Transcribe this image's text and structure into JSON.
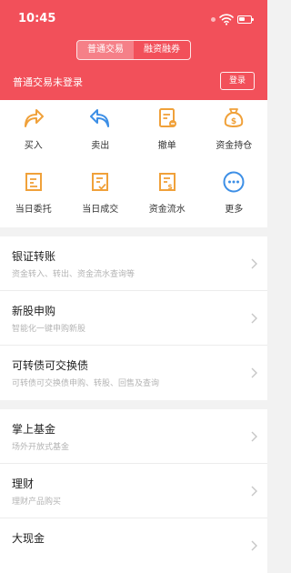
{
  "status_bar": {
    "time": "10:45"
  },
  "header": {
    "tabs": [
      "普通交易",
      "融资融券"
    ],
    "login_status": "普通交易未登录",
    "login_button": "登录"
  },
  "actions": [
    {
      "label": "买入",
      "icon": "buy-arrow-icon"
    },
    {
      "label": "卖出",
      "icon": "sell-arrow-icon"
    },
    {
      "label": "撤单",
      "icon": "cancel-order-icon"
    },
    {
      "label": "资金持仓",
      "icon": "money-bag-icon"
    },
    {
      "label": "当日委托",
      "icon": "today-order-icon"
    },
    {
      "label": "当日成交",
      "icon": "today-deal-icon"
    },
    {
      "label": "资金流水",
      "icon": "fund-flow-icon"
    },
    {
      "label": "更多",
      "icon": "more-icon"
    }
  ],
  "menu_group1": [
    {
      "title": "银证转账",
      "subtitle": "资金转入、转出、资金流水查询等"
    },
    {
      "title": "新股申购",
      "subtitle": "智能化一键申购新股"
    },
    {
      "title": "可转债可交换债",
      "subtitle": "可转债可交换债申购、转股、回售及查询"
    }
  ],
  "menu_group2": [
    {
      "title": "掌上基金",
      "subtitle": "场外开放式基金"
    },
    {
      "title": "理财",
      "subtitle": "理财产品购买"
    },
    {
      "title": "大现金",
      "subtitle": ""
    }
  ],
  "colors": {
    "header": "#f2505a",
    "orange": "#f0a13a",
    "blue": "#3d8fe6"
  }
}
